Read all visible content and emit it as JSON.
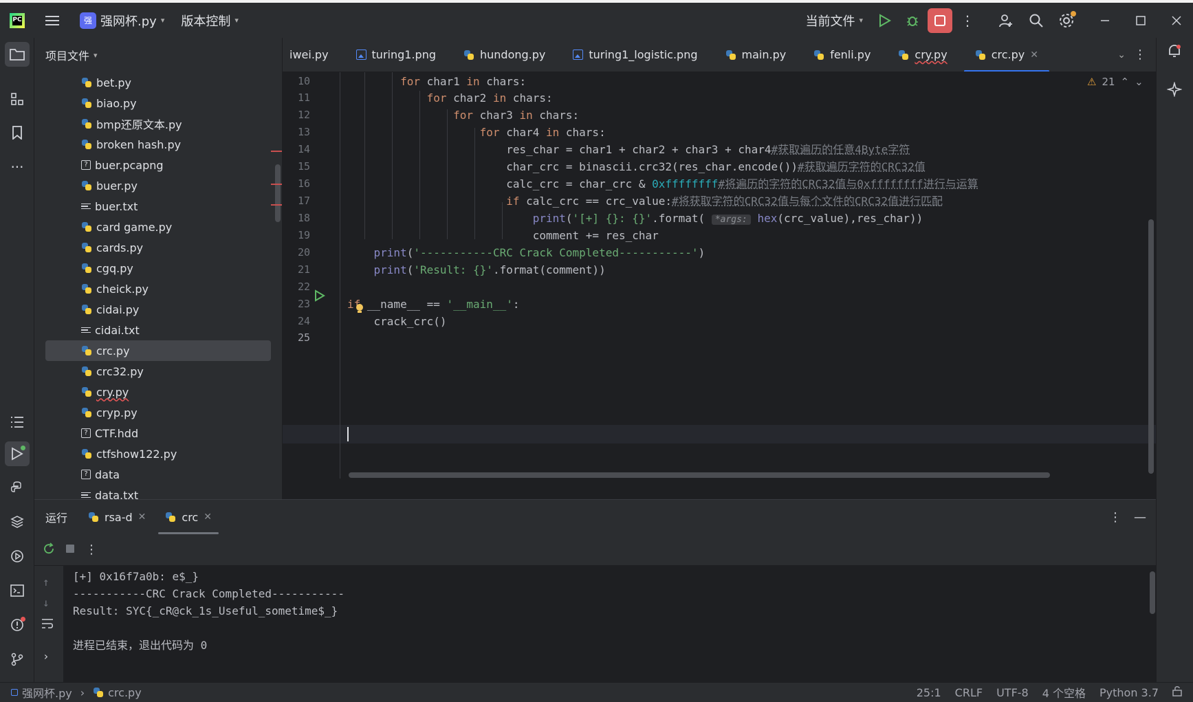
{
  "titlebar": {
    "project_badge": "强",
    "project_name": "强网杯.py",
    "vcs_label": "版本控制",
    "run_config": "当前文件"
  },
  "project_panel": {
    "title": "项目文件",
    "files": [
      {
        "name": "bet.py",
        "type": "py"
      },
      {
        "name": "biao.py",
        "type": "py"
      },
      {
        "name": "bmp还原文本.py",
        "type": "py"
      },
      {
        "name": "broken hash.py",
        "type": "py"
      },
      {
        "name": "buer.pcapng",
        "type": "unknown"
      },
      {
        "name": "buer.py",
        "type": "py"
      },
      {
        "name": "buer.txt",
        "type": "txt"
      },
      {
        "name": "card game.py",
        "type": "py"
      },
      {
        "name": "cards.py",
        "type": "py"
      },
      {
        "name": "cgq.py",
        "type": "py"
      },
      {
        "name": "cheick.py",
        "type": "py"
      },
      {
        "name": "cidai.py",
        "type": "py"
      },
      {
        "name": "cidai.txt",
        "type": "txt"
      },
      {
        "name": "crc.py",
        "type": "py",
        "selected": true
      },
      {
        "name": "crc32.py",
        "type": "py"
      },
      {
        "name": "cry.py",
        "type": "py",
        "error": true
      },
      {
        "name": "cryp.py",
        "type": "py"
      },
      {
        "name": "CTF.hdd",
        "type": "unknown"
      },
      {
        "name": "ctfshow122.py",
        "type": "py"
      },
      {
        "name": "data",
        "type": "unknown"
      },
      {
        "name": "data.txt",
        "type": "txt"
      }
    ]
  },
  "tabs": [
    {
      "label": "iwei.py",
      "type": "py"
    },
    {
      "label": "turing1.png",
      "type": "img"
    },
    {
      "label": "hundong.py",
      "type": "py"
    },
    {
      "label": "turing1_logistic.png",
      "type": "img"
    },
    {
      "label": "main.py",
      "type": "py"
    },
    {
      "label": "fenli.py",
      "type": "py"
    },
    {
      "label": "cry.py",
      "type": "py",
      "error": true
    },
    {
      "label": "crc.py",
      "type": "py",
      "active": true
    }
  ],
  "editor": {
    "warning_count": "21",
    "line_numbers": [
      "10",
      "11",
      "12",
      "13",
      "14",
      "15",
      "16",
      "17",
      "18",
      "19",
      "20",
      "21",
      "22",
      "23",
      "24",
      "25"
    ],
    "inlay_hint": "*args:",
    "comments": {
      "c14": "#获取遍历的任意4Byte字符",
      "c15": "#获取遍历字符的CRC32值",
      "c16": "#将遍历的字符的CRC32值与0xffffffff进行与运算",
      "c17": "#将获取字符的CRC32值与每个文件的CRC32值进行匹配"
    },
    "strings": {
      "s18": "'[+] {}: {}'",
      "s20": "'-----------CRC Crack Completed-----------'",
      "s21": "'Result: {}'",
      "s23": "'__main__'"
    },
    "hex_literal": "0xffffffff"
  },
  "run_panel": {
    "title": "运行",
    "tabs": [
      {
        "label": "rsa-d"
      },
      {
        "label": "crc",
        "active": true
      }
    ],
    "output": [
      "[+] 0x16f7a0b: e$_}",
      "-----------CRC Crack Completed-----------",
      "Result: SYC{_cR@ck_1s_Useful_sometime$_}",
      "",
      "进程已结束，退出代码为 0"
    ]
  },
  "statusbar": {
    "breadcrumb_project": "强网杯.py",
    "breadcrumb_file": "crc.py",
    "position": "25:1",
    "line_sep": "CRLF",
    "encoding": "UTF-8",
    "indent": "4 个空格",
    "interpreter": "Python 3.7"
  },
  "colors": {
    "accent": "#3574f0",
    "stop_button": "#db5c5c",
    "run_green": "#5fb865"
  }
}
